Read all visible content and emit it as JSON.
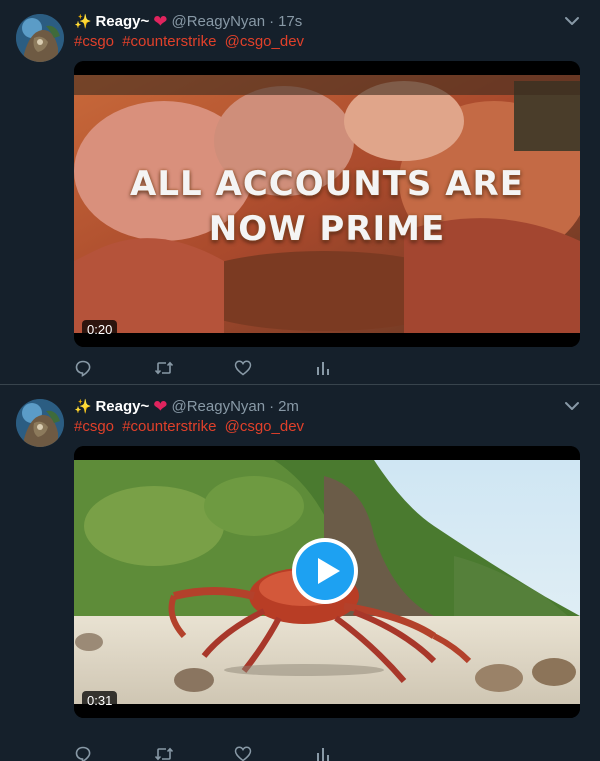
{
  "tweets": [
    {
      "author": {
        "sparkle": "✨",
        "display_name": "Reagy~",
        "heart": "❤",
        "handle": "@ReagyNyan"
      },
      "separator": "·",
      "time": "17s",
      "text": [
        "#csgo",
        "#counterstrike",
        "@csgo_dev"
      ],
      "media": {
        "type": "video",
        "overlay_lines": [
          "ALL ACCOUNTS ARE",
          "NOW PRIME"
        ],
        "duration": "0:20"
      },
      "actions": [
        "reply-icon",
        "retweet-icon",
        "like-icon",
        "analytics-icon"
      ]
    },
    {
      "author": {
        "sparkle": "✨",
        "display_name": "Reagy~",
        "heart": "❤",
        "handle": "@ReagyNyan"
      },
      "separator": "·",
      "time": "2m",
      "text": [
        "#csgo",
        "#counterstrike",
        "@csgo_dev"
      ],
      "media": {
        "type": "video",
        "duration": "0:31",
        "play_button": "play-icon"
      },
      "actions": [
        "reply-icon",
        "retweet-icon",
        "like-icon",
        "analytics-icon"
      ]
    }
  ],
  "colors": {
    "background": "#15202b",
    "divider": "#38444d",
    "secondary_text": "#8899a6",
    "hashtag": "#e0402a",
    "heart": "#e0245e",
    "play_accent": "#1da1f2"
  }
}
